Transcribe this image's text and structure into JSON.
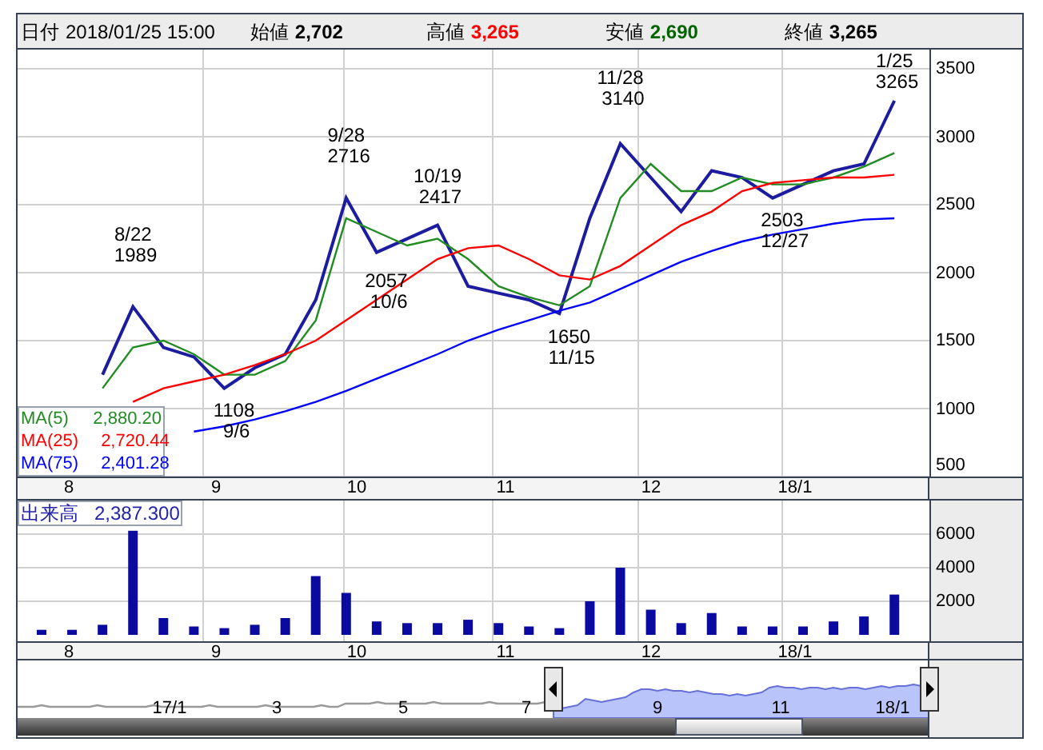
{
  "header": {
    "date_label": "日付",
    "date": "2018/01/25 15:00",
    "prices": [
      {
        "label": "始値",
        "value": "2,702",
        "color": "#000000"
      },
      {
        "label": "高値",
        "value": "3,265",
        "color": "#ff0000"
      },
      {
        "label": "安値",
        "value": "2,690",
        "color": "#006400"
      },
      {
        "label": "終値",
        "value": "3,265",
        "color": "#000000"
      }
    ]
  },
  "price_chart": {
    "month_labels": [
      "8",
      "9",
      "10",
      "11",
      "12",
      "18/1"
    ],
    "chart_data": {
      "type": "line",
      "grid": true,
      "ylim": [
        500,
        3500
      ],
      "yticks": [
        500,
        1000,
        1500,
        2000,
        2500,
        3000,
        3500
      ],
      "series": [
        {
          "color": "#1c1ca0",
          "values": [
            null,
            null,
            1250,
            1750,
            1450,
            1380,
            1150,
            1300,
            1400,
            1800,
            2550,
            2150,
            2250,
            2350,
            1900,
            1850,
            1800,
            1700,
            2400,
            2950,
            2700,
            2450,
            2750,
            2700,
            2550,
            2650,
            2750,
            2800,
            3265
          ]
        },
        {
          "color": "#228b22",
          "values": [
            null,
            null,
            1150,
            1450,
            1500,
            1400,
            1250,
            1250,
            1350,
            1650,
            2400,
            2300,
            2200,
            2250,
            2100,
            1900,
            1820,
            1760,
            1900,
            2550,
            2800,
            2600,
            2600,
            2700,
            2650,
            2650,
            2700,
            2780,
            2880
          ]
        },
        {
          "color": "#ff0000",
          "values": [
            null,
            null,
            null,
            1050,
            1150,
            1200,
            1250,
            1320,
            1400,
            1500,
            1650,
            1800,
            1950,
            2100,
            2180,
            2200,
            2100,
            1980,
            1950,
            2050,
            2200,
            2350,
            2450,
            2600,
            2660,
            2680,
            2700,
            2700,
            2720
          ]
        },
        {
          "color": "#0000ff",
          "values": [
            null,
            null,
            null,
            null,
            null,
            830,
            870,
            920,
            980,
            1050,
            1130,
            1220,
            1310,
            1400,
            1500,
            1580,
            1650,
            1720,
            1780,
            1880,
            1980,
            2080,
            2160,
            2230,
            2280,
            2320,
            2360,
            2390,
            2400
          ]
        }
      ],
      "annotations": [
        "8/22 1989",
        "1108 9/6",
        "9/28 2716",
        "2057 10/6",
        "10/19 2417",
        "1650 11/15",
        "11/28 3140",
        "2503 12/27",
        "1/25 3265"
      ]
    }
  },
  "legend": [
    {
      "label": "MA(5)",
      "value": "2,880.20",
      "color": "#228b22"
    },
    {
      "label": "MA(25)",
      "value": "2,720.44",
      "color": "#ff0000"
    },
    {
      "label": "MA(75)",
      "value": "2,401.28",
      "color": "#0000ff"
    }
  ],
  "volume_chart": {
    "label": "出来高",
    "value": "2,387.300",
    "month_labels": [
      "8",
      "9",
      "10",
      "11",
      "12",
      "18/1"
    ],
    "chart_data": {
      "type": "bar",
      "grid": true,
      "ylim": [
        0,
        8000
      ],
      "yticks": [
        2000,
        4000,
        6000
      ],
      "series": [
        {
          "color": "#0a0aa0",
          "values": [
            300,
            300,
            600,
            6200,
            1000,
            500,
            400,
            600,
            1000,
            3500,
            2500,
            800,
            700,
            700,
            900,
            700,
            500,
            400,
            2000,
            4000,
            1500,
            700,
            1300,
            500,
            500,
            500,
            800,
            1100,
            2400
          ]
        }
      ]
    }
  },
  "navigator": {
    "labels": [
      "17/1",
      "3",
      "5",
      "7",
      "9",
      "11",
      "18/1"
    ]
  }
}
